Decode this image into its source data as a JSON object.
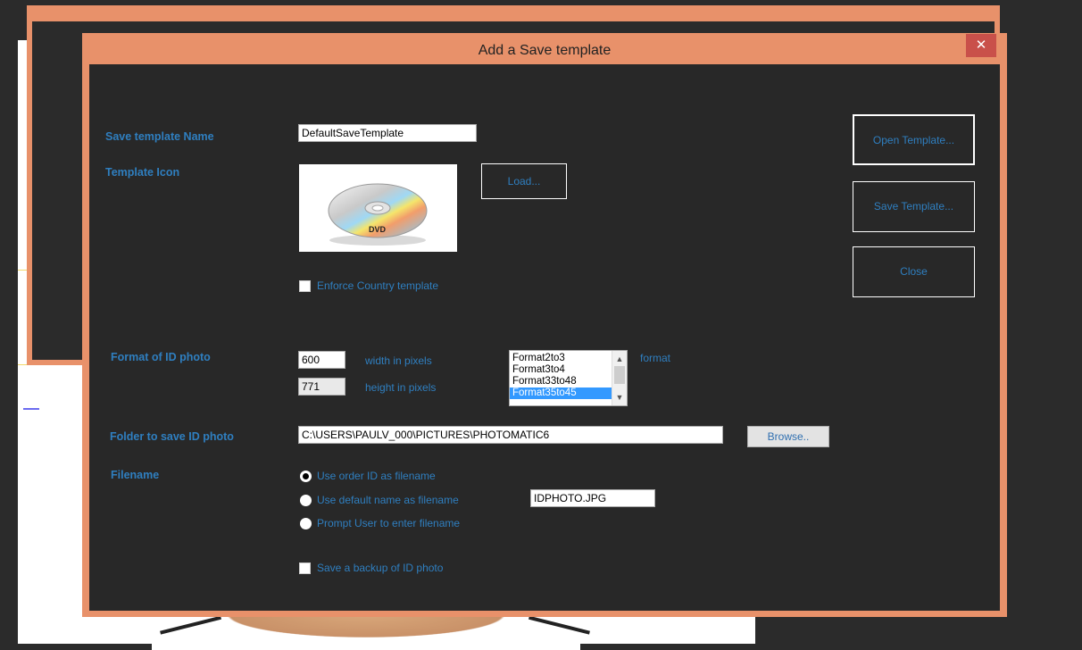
{
  "dialog": {
    "title": "Add a Save template",
    "close_glyph": "✕"
  },
  "form": {
    "template_name": {
      "label": "Save template Name",
      "value": "DefaultSaveTemplate"
    },
    "template_icon": {
      "label": "Template Icon",
      "load_button": "Load..."
    },
    "enforce_country": {
      "label": "Enforce Country template",
      "checked": false
    },
    "format": {
      "label": "Format of ID photo",
      "width_value": "600",
      "width_label": "width in pixels",
      "height_value": "771",
      "height_label": "height in pixels",
      "format_label": "format",
      "options": [
        "Format2to3",
        "Format3to4",
        "Format33to48",
        "Format35to45"
      ],
      "selected": "Format35to45"
    },
    "folder": {
      "label": "Folder to save ID photo",
      "value": "C:\\USERS\\PAULV_000\\PICTURES\\PHOTOMATIC6",
      "browse_button": "Browse.."
    },
    "filename": {
      "label": "Filename",
      "options": [
        {
          "label": "Use order ID as filename",
          "checked": true
        },
        {
          "label": "Use default name as filename",
          "checked": false
        },
        {
          "label": "Prompt User to enter filename",
          "checked": false
        }
      ],
      "default_name_value": "IDPHOTO.JPG"
    },
    "backup": {
      "label": "Save a backup of ID photo",
      "checked": false
    }
  },
  "side_buttons": {
    "open": "Open Template...",
    "save": "Save Template...",
    "close": "Close"
  },
  "colors": {
    "accent_border": "#e8916a",
    "label_blue": "#2f7fc0",
    "client_bg": "#282828",
    "close_red": "#c9504a",
    "selection_blue": "#3399ff"
  }
}
